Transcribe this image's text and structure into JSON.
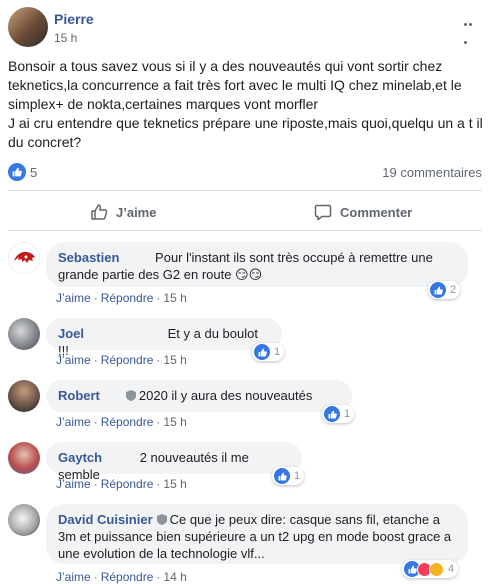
{
  "post": {
    "author": "Pierre",
    "time": "15 h",
    "text": [
      "Bonsoir a tous savez vous si il y a des nouveautés qui vont sortir chez teknetics,la concurrence a fait très fort avec le multi IQ chez minelab,et le simplex+ de nokta,certaines marques vont morfler",
      "J ai cru entendre que teknetics prépare une riposte,mais quoi,quelqu un a t il du concret?"
    ],
    "likes": "5",
    "comments_count": "19 commentaires",
    "actions": {
      "like": "J’aime",
      "comment": "Commenter"
    }
  },
  "comment_actions": {
    "like": "J’aime",
    "reply": "Répondre",
    "sep": "·"
  },
  "comments": [
    {
      "author": "Sebastien",
      "text": "Pour l'instant ils sont très occupé à remettre une grande partie des G2 en route 😏😏",
      "time": "15 h",
      "reactions": "2"
    },
    {
      "author": "Joel",
      "text": "Et y a du boulot !!!",
      "time": "15 h",
      "reactions": "1"
    },
    {
      "author": "Robert",
      "text": "2020 il y aura des nouveautés",
      "time": "15 h",
      "reactions": "1"
    },
    {
      "author": "Gaytch",
      "text": "2 nouveautés il me semble",
      "time": "15 h",
      "reactions": "1"
    },
    {
      "author": "David Cuisinier",
      "text": "Ce que je peux dire: casque sans fil, etanche a 3m et puissance bien supérieure a un t2 upg en mode boost grace a une evolution de la technologie vlf...",
      "time": "14 h",
      "reactions": "4"
    }
  ],
  "colors": {
    "link": "#385898",
    "accent": "#3578e5",
    "bubble": "#f2f3f5",
    "muted": "#606770"
  },
  "icons": [
    "more-icon",
    "like-icon",
    "thumb-up-icon",
    "comment-icon",
    "top-fan-badge-icon",
    "love-emoji-icon",
    "wow-emoji-icon"
  ]
}
